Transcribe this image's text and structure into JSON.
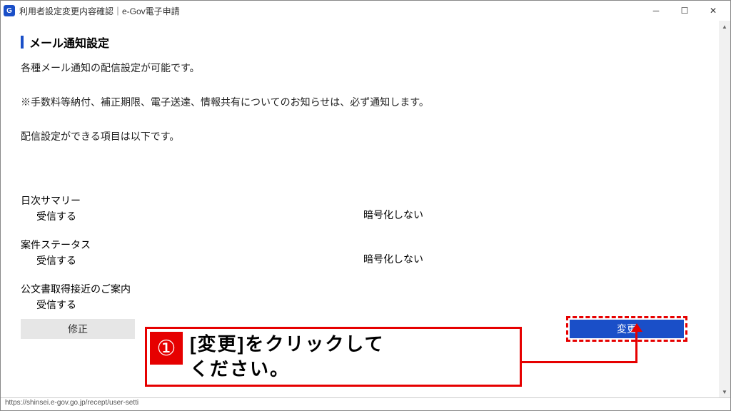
{
  "window": {
    "icon_letter": "G",
    "title": "利用者設定変更内容確認｜e-Gov電子申請"
  },
  "page": {
    "section_title": "メール通知設定",
    "para1": "各種メール通知の配信設定が可能です。",
    "para2": "※手数料等納付、補正期限、電子送達、情報共有についてのお知らせは、必ず通知します。",
    "para3": "配信設定ができる項目は以下です。"
  },
  "settings": {
    "daily_summary": {
      "label": "日次サマリー",
      "value": "受信する",
      "encryption": "暗号化しない"
    },
    "case_status": {
      "label": "案件ステータス",
      "value": "受信する",
      "encryption": "暗号化しない"
    },
    "doc_notice": {
      "label": "公文書取得接近のご案内",
      "value": "受信する"
    }
  },
  "buttons": {
    "fix": "修正",
    "change": "変更"
  },
  "callout": {
    "num": "①",
    "text_line1": "[変更]をクリックして",
    "text_line2": "ください。"
  },
  "statusbar": {
    "url": "https://shinsei.e-gov.go.jp/recept/user-setti"
  }
}
